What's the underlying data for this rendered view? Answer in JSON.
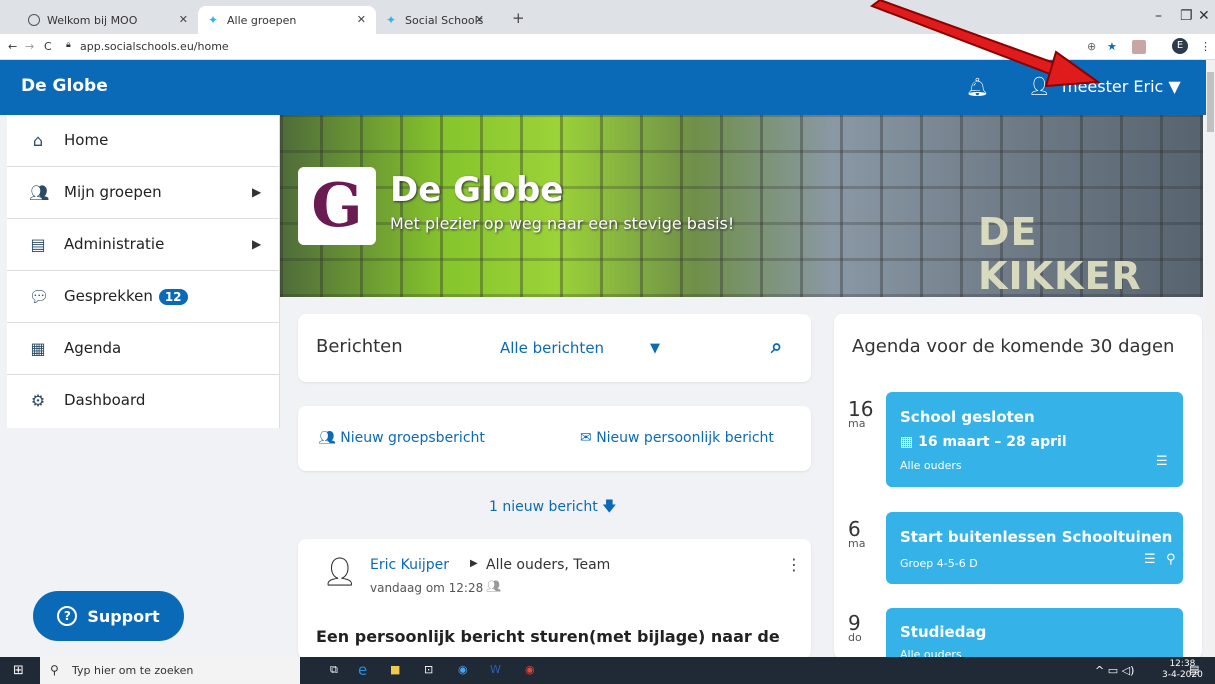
{
  "browser": {
    "tabs": [
      {
        "label": "Welkom bij MOO"
      },
      {
        "label": "Alle groepen"
      },
      {
        "label": "Social Schools"
      }
    ],
    "url": "app.socialschools.eu/home",
    "profile_initial": "E"
  },
  "header": {
    "brand": "De Globe",
    "user_name": "meester Eric"
  },
  "sidebar": {
    "items": [
      {
        "label": "Home"
      },
      {
        "label": "Mijn groepen"
      },
      {
        "label": "Administratie"
      },
      {
        "label": "Gesprekken",
        "badge": "12"
      },
      {
        "label": "Agenda"
      },
      {
        "label": "Dashboard"
      }
    ]
  },
  "support_label": "Support",
  "banner": {
    "title": "De Globe",
    "subtitle": "Met plezier op weg naar een stevige basis!",
    "logo_letter": "G",
    "building_sign": "DE KIKKER"
  },
  "messages": {
    "title": "Berichten",
    "filter": "Alle berichten",
    "new_group": "Nieuw groepsbericht",
    "new_personal": "Nieuw persoonlijk bericht",
    "new_count": "1 nieuw bericht",
    "post": {
      "author": "Eric Kuijper",
      "audience": "Alle ouders, Team",
      "time": "vandaag om 12:28",
      "headline": "Een persoonlijk bericht sturen(met bijlage) naar de"
    }
  },
  "agenda": {
    "title": "Agenda voor de komende 30 dagen",
    "events": [
      {
        "day": "16",
        "dow": "ma",
        "title": "School gesloten",
        "dates": "16 maart – 28 april",
        "audience": "Alle ouders"
      },
      {
        "day": "6",
        "dow": "ma",
        "title": "Start buitenlessen Schooltuinen",
        "audience": "Groep 4-5-6 D"
      },
      {
        "day": "9",
        "dow": "do",
        "title": "Studiedag",
        "audience": "Alle ouders"
      }
    ]
  },
  "taskbar": {
    "search_placeholder": "Typ hier om te zoeken",
    "time": "12:38",
    "date": "3-4-2020",
    "notif": "6"
  },
  "colors": {
    "primary": "#0b6ab8",
    "event": "#35b3e8"
  }
}
